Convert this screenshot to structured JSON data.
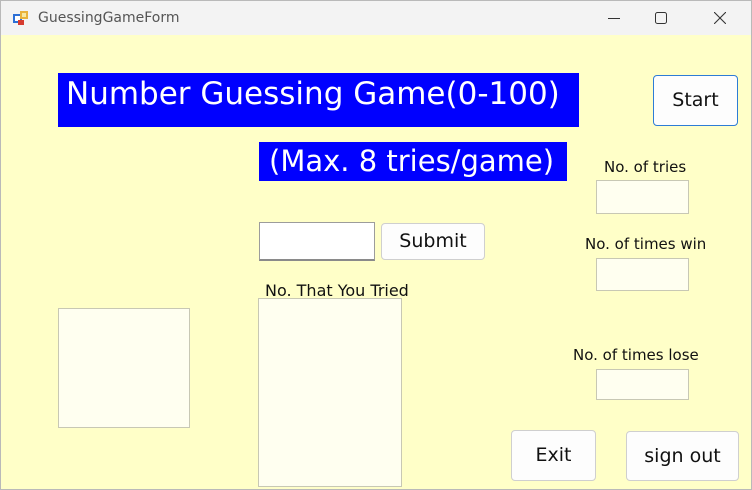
{
  "window": {
    "title": "GuessingGameForm"
  },
  "game": {
    "title": "Number Guessing Game(0-100)",
    "subtitle": "(Max. 8 tries/game)",
    "guess_input_value": "",
    "submit_label": "Submit",
    "start_label": "Start",
    "exit_label": "Exit",
    "signout_label": "sign out",
    "tried_label": "No. That You Tried",
    "tries_label": "No. of tries",
    "wins_label": "No. of times win",
    "loses_label": "No. of times lose"
  },
  "colors": {
    "background": "#ffffc8",
    "banner": "#0000ff",
    "banner_text": "#ffffff"
  }
}
